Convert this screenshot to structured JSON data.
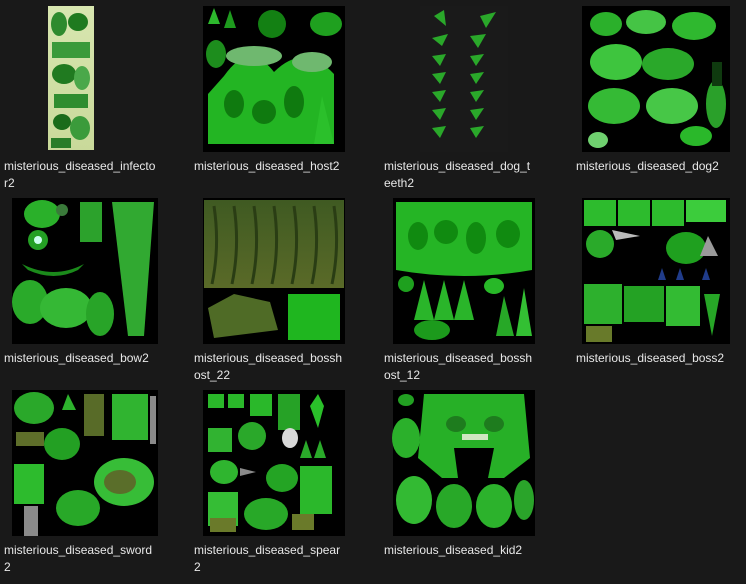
{
  "files": [
    {
      "name": "misterious_diseased_infector2",
      "thumb": "infector"
    },
    {
      "name": "misterious_diseased_host2",
      "thumb": "host"
    },
    {
      "name": "misterious_diseased_dog_teeth2",
      "thumb": "teeth"
    },
    {
      "name": "misterious_diseased_dog2",
      "thumb": "dog"
    },
    {
      "name": "misterious_diseased_bow2",
      "thumb": "bow"
    },
    {
      "name": "misterious_diseased_bosshost_22",
      "thumb": "bosshost2"
    },
    {
      "name": "misterious_diseased_bosshost_12",
      "thumb": "bosshost1"
    },
    {
      "name": "misterious_diseased_boss2",
      "thumb": "boss"
    },
    {
      "name": "misterious_diseased_sword2",
      "thumb": "sword"
    },
    {
      "name": "misterious_diseased_spear2",
      "thumb": "spear"
    },
    {
      "name": "misterious_diseased_kid2",
      "thumb": "kid"
    }
  ],
  "colors": {
    "background": "#191919",
    "texture_bg": "#000000",
    "green_bright": "#33d633",
    "green_mid": "#1a9e1a",
    "green_dark": "#0b4d0b",
    "olive": "#5a6b2a"
  }
}
